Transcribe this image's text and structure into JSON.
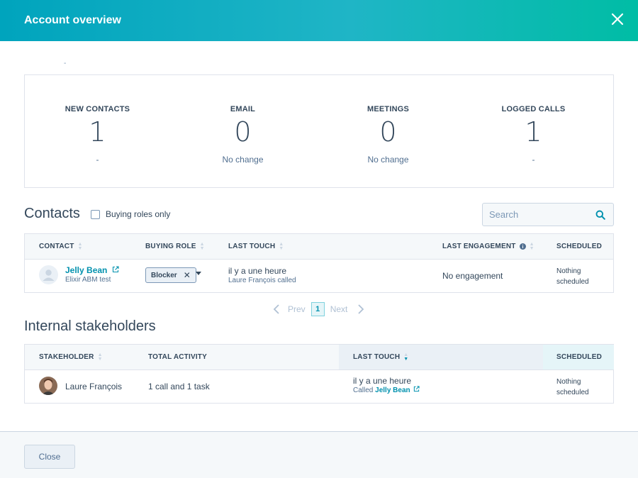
{
  "header": {
    "title": "Account overview"
  },
  "top_dash": "-",
  "stats": [
    {
      "label": "NEW CONTACTS",
      "value": "1",
      "change": "-"
    },
    {
      "label": "EMAIL",
      "value": "0",
      "change": "No change"
    },
    {
      "label": "MEETINGS",
      "value": "0",
      "change": "No change"
    },
    {
      "label": "LOGGED CALLS",
      "value": "1",
      "change": "-"
    }
  ],
  "contacts": {
    "title": "Contacts",
    "checkbox_label": "Buying roles only",
    "search_placeholder": "Search",
    "columns": [
      "CONTACT",
      "BUYING ROLE",
      "LAST TOUCH",
      "LAST ENGAGEMENT",
      "SCHEDULED"
    ],
    "row": {
      "name": "Jelly Bean",
      "company": "Elixir ABM test",
      "buying_role": "Blocker",
      "last_touch": "il y a une heure",
      "last_touch_sub": "Laure François called",
      "last_engagement": "No engagement",
      "scheduled_line1": "Nothing",
      "scheduled_line2": "scheduled"
    }
  },
  "pagination": {
    "prev": "Prev",
    "page": "1",
    "next": "Next"
  },
  "stakeholders": {
    "title": "Internal stakeholders",
    "columns": [
      "STAKEHOLDER",
      "TOTAL ACTIVITY",
      "LAST TOUCH",
      "SCHEDULED"
    ],
    "row": {
      "name": "Laure François",
      "activity": "1 call and 1 task",
      "last_touch": "il y a une heure",
      "last_touch_prefix": "Called",
      "last_touch_link": "Jelly Bean",
      "scheduled_line1": "Nothing",
      "scheduled_line2": "scheduled"
    }
  },
  "footer": {
    "close_label": "Close"
  },
  "colors": {
    "header_start": "#00a4bd",
    "header_end": "#00bda5",
    "link": "#0091ae",
    "text": "#33475b"
  }
}
